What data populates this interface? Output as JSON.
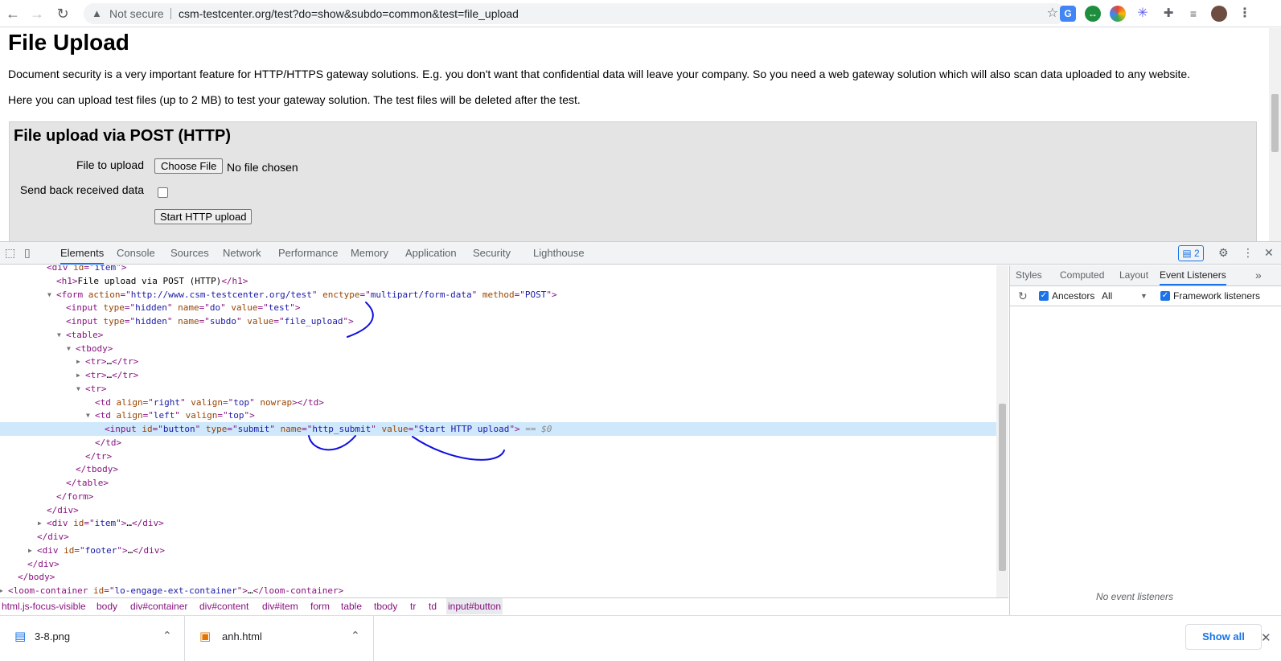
{
  "browser": {
    "not_secure": "Not secure",
    "url": "csm-testcenter.org/test?do=show&subdo=common&test=file_upload"
  },
  "page": {
    "title": "File Upload",
    "para1": "Document security is a very important feature for HTTP/HTTPS gateway solutions. E.g. you don't want that confidential data will leave your company. So you need a web gateway solution which will also scan data uploaded to any website.",
    "para2": "Here you can upload test files (up to 2 MB) to test your gateway solution. The test files will be deleted after the test.",
    "form_title": "File upload via POST (HTTP)",
    "label_file": "File to upload",
    "choose_file": "Choose File",
    "no_file": "No file chosen",
    "label_send_back": "Send back received data",
    "submit_label": "Start HTTP upload"
  },
  "devtools": {
    "tabs": [
      "Elements",
      "Console",
      "Sources",
      "Network",
      "Performance",
      "Memory",
      "Application",
      "Security",
      "Lighthouse"
    ],
    "issues_count": "2",
    "side_tabs": [
      "Styles",
      "Computed",
      "Layout",
      "Event Listeners"
    ],
    "ancestors_label": "Ancestors",
    "ancestors_filter": "All",
    "framework_label": "Framework listeners",
    "no_listeners": "No event listeners",
    "breadcrumbs": [
      "html.js-focus-visible",
      "body",
      "div#container",
      "div#content",
      "div#item",
      "form",
      "table",
      "tbody",
      "tr",
      "td",
      "input#button"
    ],
    "dom_lines": [
      {
        "indent": 4,
        "tri": "",
        "parts": [
          [
            "tag",
            "<div "
          ],
          [
            "an",
            "id"
          ],
          [
            "tag",
            "=\""
          ],
          [
            "av",
            "item"
          ],
          [
            "tag",
            "\">"
          ]
        ]
      },
      {
        "indent": 5,
        "tri": "",
        "parts": [
          [
            "tag",
            "<h1>"
          ],
          [
            "tx",
            "File upload via POST (HTTP)"
          ],
          [
            "tag",
            "</h1>"
          ]
        ]
      },
      {
        "indent": 5,
        "tri": "▼",
        "parts": [
          [
            "tag",
            "<form "
          ],
          [
            "an",
            "action"
          ],
          [
            "tag",
            "=\""
          ],
          [
            "av",
            "http://www.csm-testcenter.org/test"
          ],
          [
            "tag",
            "\" "
          ],
          [
            "an",
            "enctype"
          ],
          [
            "tag",
            "=\""
          ],
          [
            "av",
            "multipart/form-data"
          ],
          [
            "tag",
            "\" "
          ],
          [
            "an",
            "method"
          ],
          [
            "tag",
            "=\""
          ],
          [
            "av",
            "POST"
          ],
          [
            "tag",
            "\">"
          ]
        ]
      },
      {
        "indent": 6,
        "tri": "",
        "parts": [
          [
            "tag",
            "<input "
          ],
          [
            "an",
            "type"
          ],
          [
            "tag",
            "=\""
          ],
          [
            "av",
            "hidden"
          ],
          [
            "tag",
            "\" "
          ],
          [
            "an",
            "name"
          ],
          [
            "tag",
            "=\""
          ],
          [
            "av",
            "do"
          ],
          [
            "tag",
            "\" "
          ],
          [
            "an",
            "value"
          ],
          [
            "tag",
            "=\""
          ],
          [
            "av",
            "test"
          ],
          [
            "tag",
            "\">"
          ]
        ]
      },
      {
        "indent": 6,
        "tri": "",
        "parts": [
          [
            "tag",
            "<input "
          ],
          [
            "an",
            "type"
          ],
          [
            "tag",
            "=\""
          ],
          [
            "av",
            "hidden"
          ],
          [
            "tag",
            "\" "
          ],
          [
            "an",
            "name"
          ],
          [
            "tag",
            "=\""
          ],
          [
            "av",
            "subdo"
          ],
          [
            "tag",
            "\" "
          ],
          [
            "an",
            "value"
          ],
          [
            "tag",
            "=\""
          ],
          [
            "av",
            "file_upload"
          ],
          [
            "tag",
            "\">"
          ]
        ]
      },
      {
        "indent": 6,
        "tri": "▼",
        "parts": [
          [
            "tag",
            "<table>"
          ]
        ]
      },
      {
        "indent": 7,
        "tri": "▼",
        "parts": [
          [
            "tag",
            "<tbody>"
          ]
        ]
      },
      {
        "indent": 8,
        "tri": "▶",
        "parts": [
          [
            "tag",
            "<tr>"
          ],
          [
            "tx",
            "…"
          ],
          [
            "tag",
            "</tr>"
          ]
        ]
      },
      {
        "indent": 8,
        "tri": "▶",
        "parts": [
          [
            "tag",
            "<tr>"
          ],
          [
            "tx",
            "…"
          ],
          [
            "tag",
            "</tr>"
          ]
        ]
      },
      {
        "indent": 8,
        "tri": "▼",
        "parts": [
          [
            "tag",
            "<tr>"
          ]
        ]
      },
      {
        "indent": 9,
        "tri": "",
        "parts": [
          [
            "tag",
            "<td "
          ],
          [
            "an",
            "align"
          ],
          [
            "tag",
            "=\""
          ],
          [
            "av",
            "right"
          ],
          [
            "tag",
            "\" "
          ],
          [
            "an",
            "valign"
          ],
          [
            "tag",
            "=\""
          ],
          [
            "av",
            "top"
          ],
          [
            "tag",
            "\" "
          ],
          [
            "an",
            "nowrap"
          ],
          [
            "tag",
            "></td>"
          ]
        ]
      },
      {
        "indent": 9,
        "tri": "▼",
        "parts": [
          [
            "tag",
            "<td "
          ],
          [
            "an",
            "align"
          ],
          [
            "tag",
            "=\""
          ],
          [
            "av",
            "left"
          ],
          [
            "tag",
            "\" "
          ],
          [
            "an",
            "valign"
          ],
          [
            "tag",
            "=\""
          ],
          [
            "av",
            "top"
          ],
          [
            "tag",
            "\">"
          ]
        ]
      },
      {
        "indent": 10,
        "tri": "",
        "sel": true,
        "parts": [
          [
            "tag",
            "<input "
          ],
          [
            "an",
            "id"
          ],
          [
            "tag",
            "=\""
          ],
          [
            "av",
            "button"
          ],
          [
            "tag",
            "\" "
          ],
          [
            "an",
            "type"
          ],
          [
            "tag",
            "=\""
          ],
          [
            "av",
            "submit"
          ],
          [
            "tag",
            "\" "
          ],
          [
            "an",
            "name"
          ],
          [
            "tag",
            "=\""
          ],
          [
            "av",
            "http_submit"
          ],
          [
            "tag",
            "\" "
          ],
          [
            "an",
            "value"
          ],
          [
            "tag",
            "=\""
          ],
          [
            "av",
            "Start HTTP upload"
          ],
          [
            "tag",
            "\">"
          ],
          [
            "cm",
            " == $0"
          ]
        ]
      },
      {
        "indent": 9,
        "tri": "",
        "parts": [
          [
            "tag",
            "</td>"
          ]
        ]
      },
      {
        "indent": 8,
        "tri": "",
        "parts": [
          [
            "tag",
            "</tr>"
          ]
        ]
      },
      {
        "indent": 7,
        "tri": "",
        "parts": [
          [
            "tag",
            "</tbody>"
          ]
        ]
      },
      {
        "indent": 6,
        "tri": "",
        "parts": [
          [
            "tag",
            "</table>"
          ]
        ]
      },
      {
        "indent": 5,
        "tri": "",
        "parts": [
          [
            "tag",
            "</form>"
          ]
        ]
      },
      {
        "indent": 4,
        "tri": "",
        "parts": [
          [
            "tag",
            "</div>"
          ]
        ]
      },
      {
        "indent": 4,
        "tri": "▶",
        "parts": [
          [
            "tag",
            "<div "
          ],
          [
            "an",
            "id"
          ],
          [
            "tag",
            "=\""
          ],
          [
            "av",
            "item"
          ],
          [
            "tag",
            "\">"
          ],
          [
            "tx",
            "…"
          ],
          [
            "tag",
            "</div>"
          ]
        ]
      },
      {
        "indent": 3,
        "tri": "",
        "parts": [
          [
            "tag",
            "</div>"
          ]
        ]
      },
      {
        "indent": 3,
        "tri": "▶",
        "parts": [
          [
            "tag",
            "<div "
          ],
          [
            "an",
            "id"
          ],
          [
            "tag",
            "=\""
          ],
          [
            "av",
            "footer"
          ],
          [
            "tag",
            "\">"
          ],
          [
            "tx",
            "…"
          ],
          [
            "tag",
            "</div>"
          ]
        ]
      },
      {
        "indent": 2,
        "tri": "",
        "parts": [
          [
            "tag",
            "</div>"
          ]
        ]
      },
      {
        "indent": 1,
        "tri": "",
        "parts": [
          [
            "tag",
            "</body>"
          ]
        ]
      },
      {
        "indent": 0,
        "tri": "▶",
        "parts": [
          [
            "tag",
            "<loom-container "
          ],
          [
            "an",
            "id"
          ],
          [
            "tag",
            "=\""
          ],
          [
            "av",
            "lo-engage-ext-container"
          ],
          [
            "tag",
            "\">"
          ],
          [
            "tx",
            "…"
          ],
          [
            "tag",
            "</loom-container>"
          ]
        ]
      }
    ]
  },
  "downloads": {
    "items": [
      "3-8.png",
      "anh.html"
    ],
    "show_all": "Show all"
  },
  "colors": {
    "accent": "#1a73e8",
    "selection": "#cfe8fc",
    "annotation_ink": "#1010e0"
  }
}
